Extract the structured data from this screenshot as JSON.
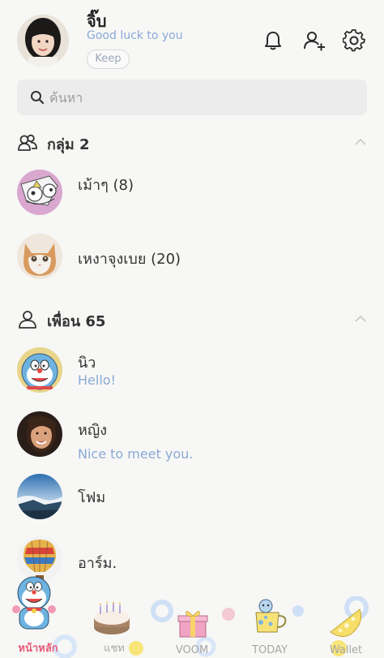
{
  "profile": {
    "name": "จิ๊บ",
    "status": "Good luck to you",
    "keep_label": "Keep"
  },
  "search": {
    "placeholder": "ค้นหา"
  },
  "groups": {
    "title": "กลุ่ม 2",
    "items": [
      {
        "label": "เม้าๆ (8)"
      },
      {
        "label": "เหงาจุงเบย (20)"
      }
    ]
  },
  "friends": {
    "title": "เพื่อน 65",
    "items": [
      {
        "label": "นิว",
        "status": "Hello!"
      },
      {
        "label": "หญิง",
        "status": "Nice to meet you."
      },
      {
        "label": "โฟม",
        "status": ""
      },
      {
        "label": "อาร์ม.",
        "status": ""
      }
    ]
  },
  "nav": {
    "items": [
      {
        "label": "หน้าหลัก",
        "active": true
      },
      {
        "label": "แชท"
      },
      {
        "label": "VOOM"
      },
      {
        "label": "TODAY"
      },
      {
        "label": "Wallet"
      }
    ]
  },
  "colors": {
    "accent_active": "#e75a79",
    "status_text": "#8aa9d6",
    "background": "#f7f7f5"
  }
}
